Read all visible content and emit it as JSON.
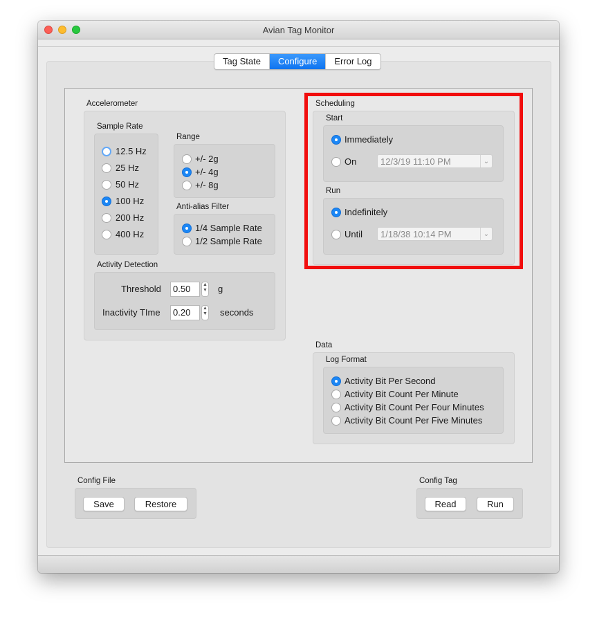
{
  "window": {
    "title": "Avian Tag Monitor"
  },
  "tabs": [
    {
      "label": "Tag State",
      "active": false
    },
    {
      "label": "Configure",
      "active": true
    },
    {
      "label": "Error Log",
      "active": false
    }
  ],
  "accelerometer": {
    "title": "Accelerometer",
    "sample_rate": {
      "title": "Sample Rate",
      "options": [
        "12.5 Hz",
        "25 Hz",
        "50 Hz",
        "100 Hz",
        "200 Hz",
        "400 Hz"
      ],
      "selected": "100 Hz"
    },
    "range": {
      "title": "Range",
      "options": [
        "+/- 2g",
        "+/- 4g",
        "+/- 8g"
      ],
      "selected": "+/- 4g"
    },
    "anti_alias": {
      "title": "Anti-alias Filter",
      "options": [
        "1/4 Sample Rate",
        "1/2 Sample Rate"
      ],
      "selected": "1/4 Sample Rate"
    },
    "activity_detection": {
      "title": "Activity Detection",
      "threshold_label": "Threshold",
      "threshold_value": "0.50",
      "threshold_unit": "g",
      "inactivity_label": "Inactivity TIme",
      "inactivity_value": "0.20",
      "inactivity_unit": "seconds"
    }
  },
  "scheduling": {
    "title": "Scheduling",
    "start": {
      "title": "Start",
      "immediately_label": "Immediately",
      "on_label": "On",
      "on_date": "12/3/19 11:10 PM",
      "selected": "Immediately"
    },
    "run": {
      "title": "Run",
      "indefinitely_label": "Indefinitely",
      "until_label": "Until",
      "until_date": "1/18/38 10:14 PM",
      "selected": "Indefinitely"
    }
  },
  "data": {
    "title": "Data",
    "log_format": {
      "title": "Log Format",
      "options": [
        "Activity Bit Per Second",
        "Activity Bit Count Per Minute",
        "Activity Bit Count Per Four Minutes",
        "Activity Bit Count Per Five Minutes"
      ],
      "selected": "Activity Bit Per Second"
    }
  },
  "config_file": {
    "title": "Config File",
    "save_label": "Save",
    "restore_label": "Restore"
  },
  "config_tag": {
    "title": "Config Tag",
    "read_label": "Read",
    "run_label": "Run"
  },
  "colors": {
    "accent": "#1c87f5",
    "highlight": "#f10d0d",
    "tab_active": "#1f7ff5"
  },
  "icons": {
    "stepper": "stepper-arrows-icon",
    "popup": "chevron-updown-icon"
  }
}
